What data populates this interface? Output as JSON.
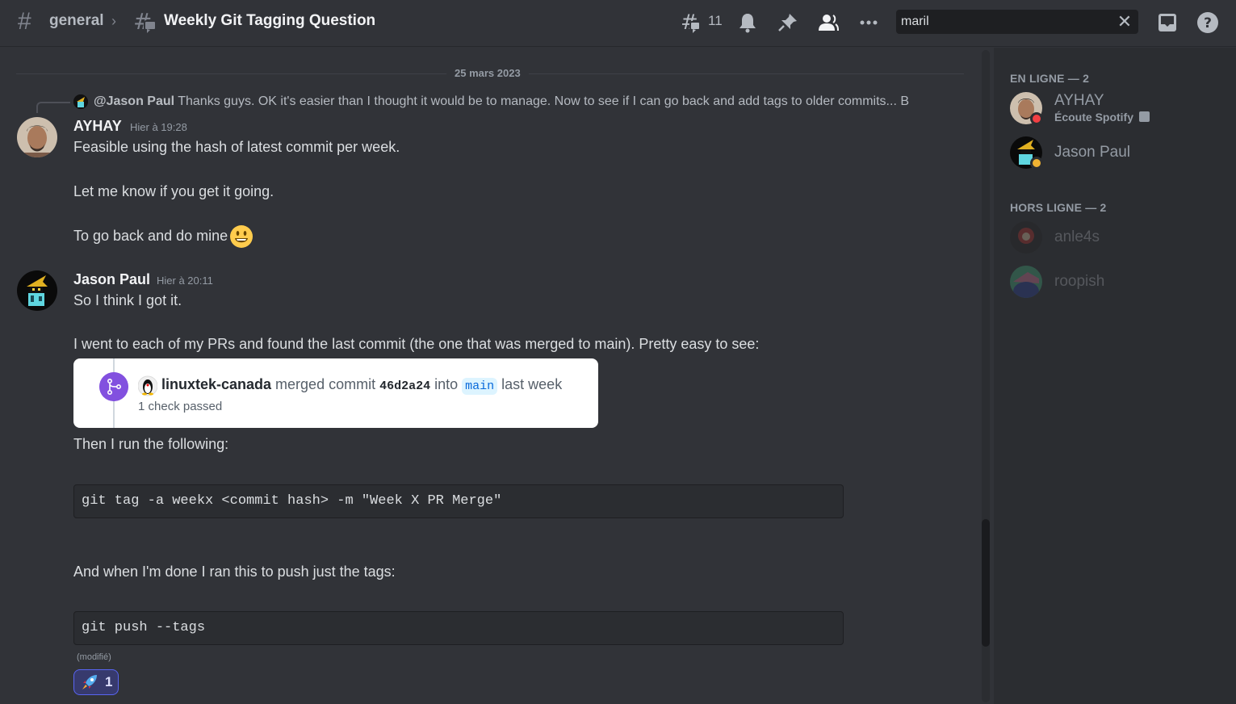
{
  "header": {
    "channel": "general",
    "separator": "›",
    "thread_title": "Weekly Git Tagging Question",
    "threads_count": "11",
    "search_value": "maril",
    "icons": [
      "threads-icon",
      "bell-icon",
      "pin-icon",
      "members-icon",
      "more-icon",
      "inbox-icon",
      "help-icon"
    ]
  },
  "chat": {
    "date_divider": "25 mars 2023",
    "reply": {
      "mention": "@Jason Paul",
      "text": " Thanks guys. OK it's easier than I thought it would be to manage. Now to see if I can go back and add tags to older commits... B"
    },
    "messages": [
      {
        "author": "AYHAY",
        "timestamp": "Hier à 19:28",
        "lines": [
          "Feasible using the hash of latest commit per week.",
          "Let me know if you get it going.",
          "To go back and do mine"
        ],
        "emoji": "smiley"
      },
      {
        "author": "Jason Paul",
        "timestamp": "Hier à 20:11",
        "lines": [
          "So I think I got it.",
          "I went to each of my PRs and found the last commit (the one that was merged to main).  Pretty easy to see:",
          "Then I run the following:",
          "And when I'm done I ran this to push just the tags:"
        ],
        "embed": {
          "user": "linuxtek-canada",
          "action": " merged commit ",
          "hash": "46d2a24",
          "into": " into ",
          "branch": "main",
          "when": " last week",
          "checks": "1 check passed"
        },
        "code_blocks": [
          "git tag -a weekx <commit hash> -m \"Week X PR Merge\"",
          "git push --tags"
        ],
        "edited_label": "(modifié)",
        "reaction": {
          "emoji": "rocket",
          "count": "1"
        }
      }
    ]
  },
  "members": {
    "online_title": "EN LIGNE — 2",
    "offline_title": "HORS LIGNE — 2",
    "online": [
      {
        "name": "AYHAY",
        "activity": "Écoute Spotify",
        "status": "dnd"
      },
      {
        "name": "Jason Paul",
        "status": "idle"
      }
    ],
    "offline": [
      {
        "name": "anle4s"
      },
      {
        "name": "roopish"
      }
    ]
  },
  "colors": {
    "accent": "#5865f2",
    "dnd": "#f23f43",
    "idle": "#f0b232",
    "merge_purple": "#8250df"
  }
}
